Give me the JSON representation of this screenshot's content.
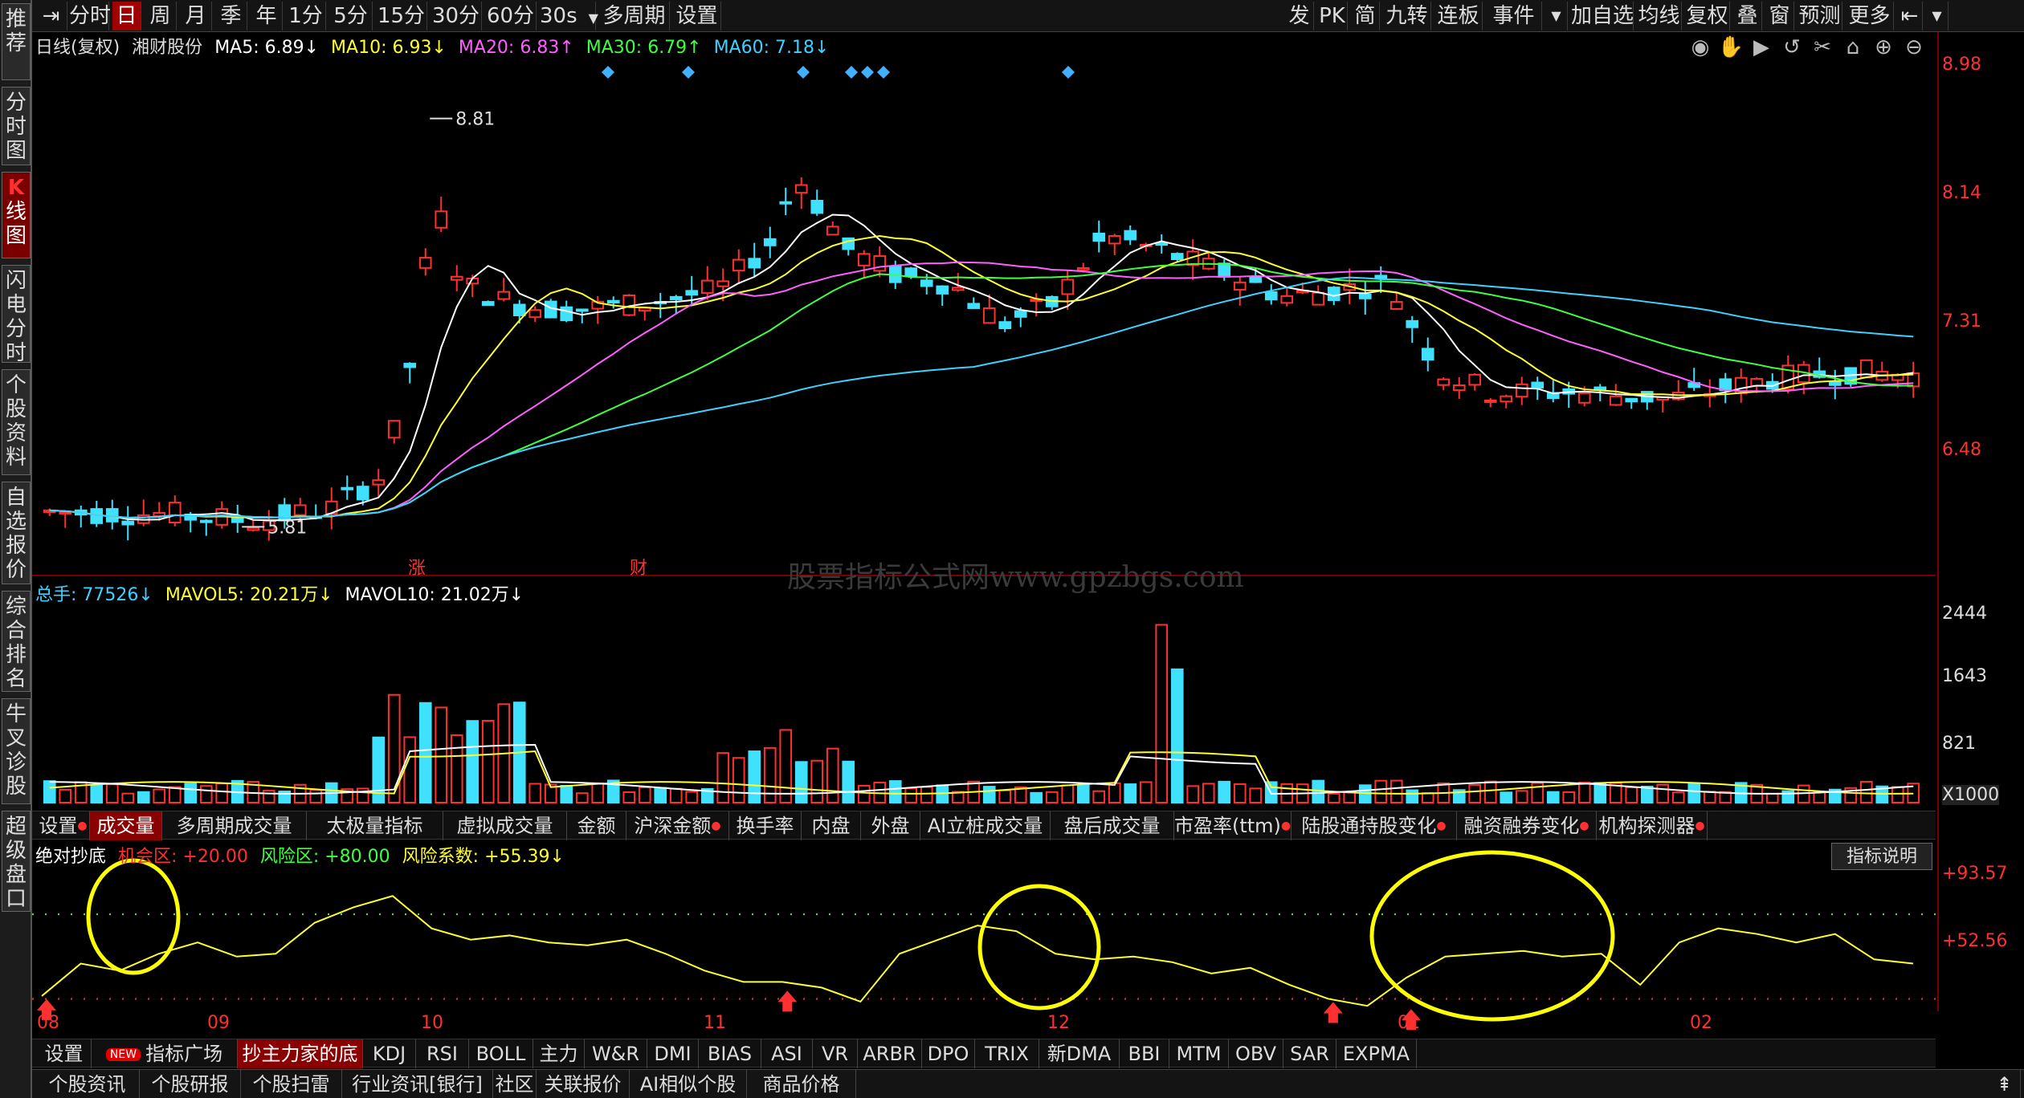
{
  "sidebar": [
    {
      "label": "推荐",
      "icon": ""
    },
    {
      "label": "分时图",
      "icon": ""
    },
    {
      "label": "线图",
      "icon": "K"
    },
    {
      "label": "闪电分时",
      "icon": ""
    },
    {
      "label": "个股资料",
      "icon": ""
    },
    {
      "label": "自选报价",
      "icon": ""
    },
    {
      "label": "综合排名",
      "icon": ""
    },
    {
      "label": "牛叉诊股",
      "icon": ""
    },
    {
      "label": "超级盘口",
      "icon": ""
    }
  ],
  "toolbar": {
    "left": [
      "分时",
      "日",
      "周",
      "月",
      "季",
      "年",
      "1分",
      "5分",
      "15分",
      "30分",
      "60分",
      "30s",
      "多周期",
      "设置"
    ],
    "right": [
      "发",
      "PK",
      "简",
      "九转",
      "连板",
      "事件",
      "加自选",
      "均线",
      "复权",
      "叠",
      "窗",
      "预测",
      "更多"
    ]
  },
  "kline": {
    "header": {
      "period": "日线(复权)",
      "stock": "湘财股份",
      "ma5": "MA5: 6.89↓",
      "ma10": "MA10: 6.93↓",
      "ma20": "MA20: 6.83↑",
      "ma30": "MA30: 6.79↑",
      "ma60": "MA60: 7.18↓"
    },
    "yaxis": [
      "8.98",
      "8.14",
      "7.31",
      "6.48"
    ],
    "high_label": "8.81",
    "low_label": "5.81",
    "annot_zhang": "涨",
    "annot_cai": "财"
  },
  "watermark": "股票指标公式网www.gpzbgs.com",
  "volume": {
    "header": {
      "total": "总手: 77526↓",
      "mavol5": "MAVOL5: 20.21万↓",
      "mavol10": "MAVOL10: 21.02万↓"
    },
    "yaxis": [
      "2444",
      "1643",
      "821",
      "X1000"
    ]
  },
  "tabs1": [
    "设置",
    "成交量",
    "多周期成交量",
    "太极量指标",
    "虚拟成交量",
    "金额",
    "沪深金额",
    "换手率",
    "内盘",
    "外盘",
    "AI立桩成交量",
    "盘后成交量",
    "市盈率(ttm)",
    "陆股通持股变化",
    "融资融券变化",
    "机构探测器"
  ],
  "indicator": {
    "header": {
      "name": "绝对抄底",
      "chance": "机会区: +20.00",
      "risk": "风险区: +80.00",
      "coef": "风险系数: +55.39↓"
    },
    "yaxis": [
      "+93.57",
      "+52.56"
    ],
    "help": "指标说明"
  },
  "xaxis": [
    "08",
    "09",
    "10",
    "11",
    "12",
    "01",
    "02"
  ],
  "tabs2": [
    "设置",
    "指标广场",
    "抄主力家的底",
    "KDJ",
    "RSI",
    "BOLL",
    "主力",
    "W&R",
    "DMI",
    "BIAS",
    "ASI",
    "VR",
    "ARBR",
    "DPO",
    "TRIX",
    "新DMA",
    "BBI",
    "MTM",
    "OBV",
    "SAR",
    "EXPMA"
  ],
  "tabs2_new": "NEW",
  "bottom": [
    "个股资讯",
    "个股研报",
    "个股扫雷",
    "行业资讯[银行]",
    "社区",
    "关联报价",
    "AI相似个股",
    "商品价格"
  ],
  "chart_data": {
    "type": "line",
    "x": [
      "08",
      "09",
      "10",
      "11",
      "12",
      "01",
      "02"
    ],
    "series": [
      {
        "name": "绝对抄底",
        "values": [
          22,
          45,
          40,
          52,
          60,
          50,
          52,
          74,
          85,
          93,
          70,
          62,
          65,
          60,
          58,
          62,
          52,
          40,
          32,
          32,
          28,
          18,
          52,
          62,
          72,
          68,
          52,
          48,
          50,
          46,
          38,
          42,
          30,
          20,
          15,
          35,
          50,
          52,
          54,
          50,
          52,
          30,
          60,
          70,
          66,
          60,
          66,
          48,
          45
        ]
      }
    ]
  }
}
